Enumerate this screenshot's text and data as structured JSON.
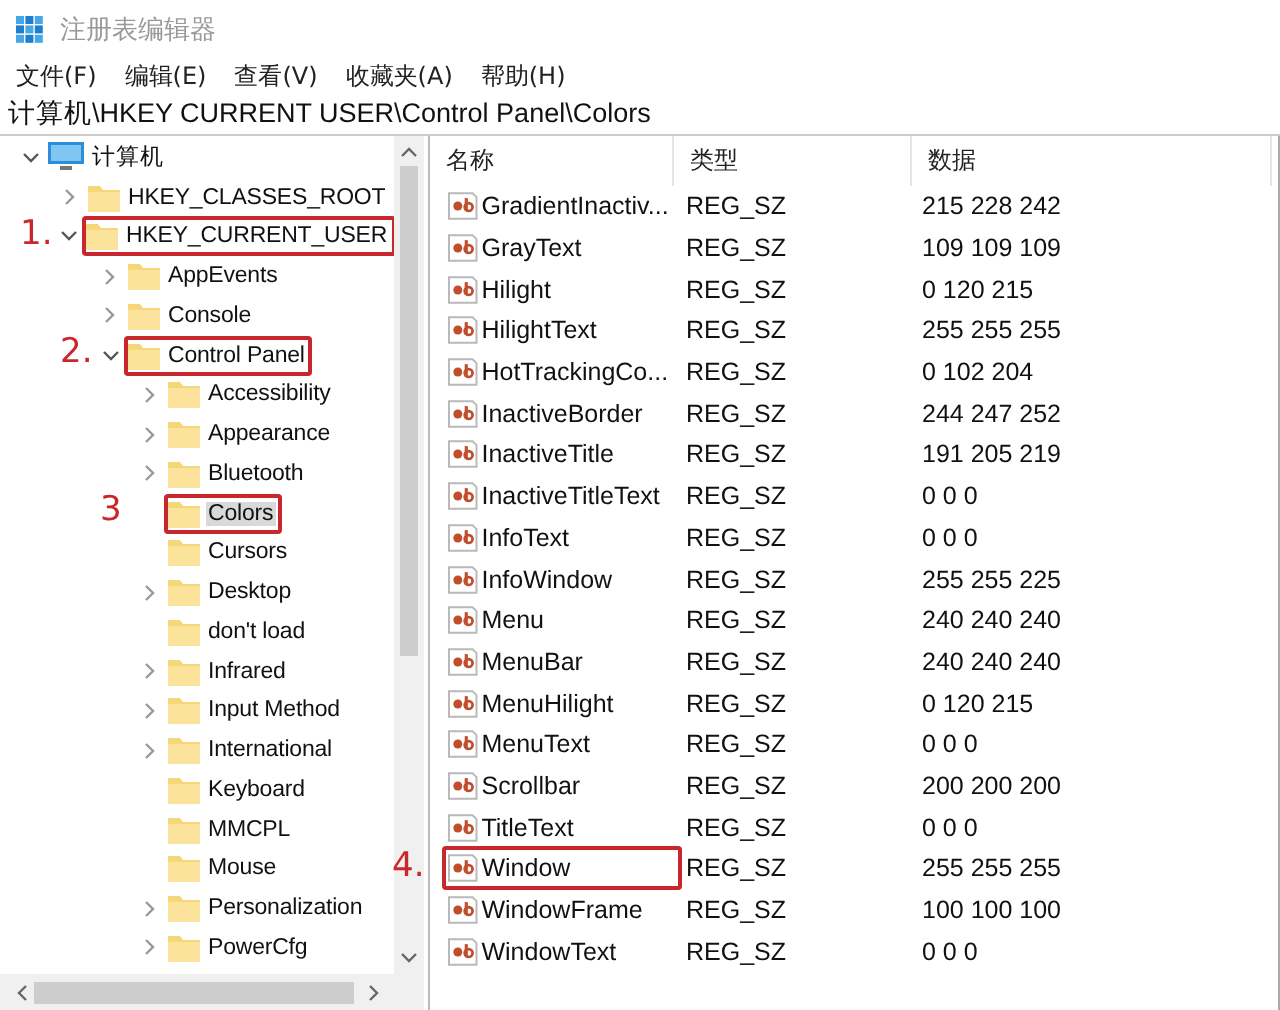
{
  "window": {
    "title": "注册表编辑器"
  },
  "menu": [
    "文件(F)",
    "编辑(E)",
    "查看(V)",
    "收藏夹(A)",
    "帮助(H)"
  ],
  "address": "计算机\\HKEY CURRENT USER\\Control Panel\\Colors",
  "tree": [
    {
      "label": "计算机",
      "kind": "computer",
      "expanded": true,
      "selected": false,
      "children": [
        {
          "label": "HKEY_CLASSES_ROOT",
          "kind": "folder",
          "expanded": false,
          "selected": false
        },
        {
          "label": "HKEY_CURRENT_USER",
          "kind": "folder",
          "expanded": true,
          "selected": false,
          "callout": "1.",
          "children": [
            {
              "label": "AppEvents",
              "kind": "folder",
              "expanded": false,
              "selected": false
            },
            {
              "label": "Console",
              "kind": "folder",
              "expanded": false,
              "selected": false
            },
            {
              "label": "Control Panel",
              "kind": "folder",
              "expanded": true,
              "selected": false,
              "callout": "2.",
              "children": [
                {
                  "label": "Accessibility",
                  "kind": "folder",
                  "expanded": false,
                  "selected": false
                },
                {
                  "label": "Appearance",
                  "kind": "folder",
                  "expanded": false,
                  "selected": false
                },
                {
                  "label": "Bluetooth",
                  "kind": "folder",
                  "expanded": false,
                  "selected": false
                },
                {
                  "label": "Colors",
                  "kind": "folder",
                  "selected": true,
                  "callout": "3"
                },
                {
                  "label": "Cursors",
                  "kind": "folder",
                  "selected": false
                },
                {
                  "label": "Desktop",
                  "kind": "folder",
                  "expanded": false,
                  "selected": false
                },
                {
                  "label": "don't load",
                  "kind": "folder",
                  "selected": false
                },
                {
                  "label": "Infrared",
                  "kind": "folder",
                  "expanded": false,
                  "selected": false
                },
                {
                  "label": "Input Method",
                  "kind": "folder",
                  "expanded": false,
                  "selected": false
                },
                {
                  "label": "International",
                  "kind": "folder",
                  "expanded": false,
                  "selected": false
                },
                {
                  "label": "Keyboard",
                  "kind": "folder",
                  "selected": false
                },
                {
                  "label": "MMCPL",
                  "kind": "folder",
                  "selected": false
                },
                {
                  "label": "Mouse",
                  "kind": "folder",
                  "selected": false
                },
                {
                  "label": "Personalization",
                  "kind": "folder",
                  "expanded": false,
                  "selected": false
                },
                {
                  "label": "PowerCfg",
                  "kind": "folder",
                  "expanded": false,
                  "selected": false
                }
              ]
            }
          ]
        }
      ]
    }
  ],
  "table": {
    "columns": [
      "名称",
      "类型",
      "数据"
    ],
    "rows": [
      {
        "name": "GradientInactiv...",
        "type": "REG_SZ",
        "data": "215 228 242"
      },
      {
        "name": "GrayText",
        "type": "REG_SZ",
        "data": "109 109 109"
      },
      {
        "name": "Hilight",
        "type": "REG_SZ",
        "data": "0 120 215"
      },
      {
        "name": "HilightText",
        "type": "REG_SZ",
        "data": "255 255 255"
      },
      {
        "name": "HotTrackingCo...",
        "type": "REG_SZ",
        "data": "0 102 204"
      },
      {
        "name": "InactiveBorder",
        "type": "REG_SZ",
        "data": "244 247 252"
      },
      {
        "name": "InactiveTitle",
        "type": "REG_SZ",
        "data": "191 205 219"
      },
      {
        "name": "InactiveTitleText",
        "type": "REG_SZ",
        "data": "0 0 0"
      },
      {
        "name": "InfoText",
        "type": "REG_SZ",
        "data": "0 0 0"
      },
      {
        "name": "InfoWindow",
        "type": "REG_SZ",
        "data": "255 255 225"
      },
      {
        "name": "Menu",
        "type": "REG_SZ",
        "data": "240 240 240"
      },
      {
        "name": "MenuBar",
        "type": "REG_SZ",
        "data": "240 240 240"
      },
      {
        "name": "MenuHilight",
        "type": "REG_SZ",
        "data": "0 120 215"
      },
      {
        "name": "MenuText",
        "type": "REG_SZ",
        "data": "0 0 0"
      },
      {
        "name": "Scrollbar",
        "type": "REG_SZ",
        "data": "200 200 200"
      },
      {
        "name": "TitleText",
        "type": "REG_SZ",
        "data": "0 0 0"
      },
      {
        "name": "Window",
        "type": "REG_SZ",
        "data": "255 255 255",
        "callout": "4."
      },
      {
        "name": "WindowFrame",
        "type": "REG_SZ",
        "data": "100 100 100"
      },
      {
        "name": "WindowText",
        "type": "REG_SZ",
        "data": "0 0 0"
      }
    ]
  }
}
